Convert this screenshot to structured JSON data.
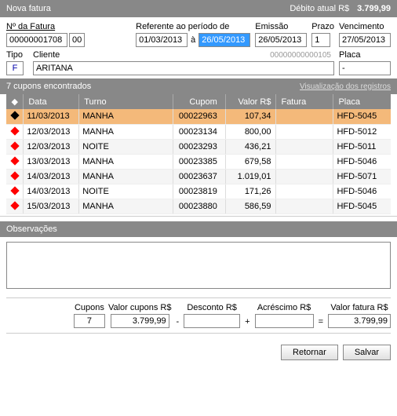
{
  "header": {
    "title": "Nova fatura",
    "debit_label": "Débito atual R$",
    "debit_value": "3.799,99"
  },
  "form": {
    "fatura_label": "Nº da Fatura",
    "fatura_num": "00000001708",
    "fatura_seq": "00",
    "ref_label": "Referente ao período de",
    "ref_from": "01/03/2013",
    "ref_sep": "à",
    "ref_to": "26/05/2013",
    "emissao_label": "Emissão",
    "emissao": "26/05/2013",
    "prazo_label": "Prazo",
    "prazo": "1",
    "venc_label": "Vencimento",
    "venc": "27/05/2013",
    "tipo_label": "Tipo",
    "tipo": "F",
    "cliente_label": "Cliente",
    "cliente": "ARITANA",
    "cliente_id": "00000000000105",
    "placa_label": "Placa",
    "placa": "-"
  },
  "list": {
    "count_label": "7 cupons encontrados",
    "vis_label": "Visualização dos registros",
    "cols": {
      "data": "Data",
      "turno": "Turno",
      "cupom": "Cupom",
      "valor": "Valor R$",
      "fatura": "Fatura",
      "placa": "Placa"
    },
    "rows": [
      {
        "sel": true,
        "data": "11/03/2013",
        "turno": "MANHA",
        "cupom": "00022963",
        "valor": "107,34",
        "fatura": "",
        "placa": "HFD-5045"
      },
      {
        "sel": false,
        "data": "12/03/2013",
        "turno": "MANHA",
        "cupom": "00023134",
        "valor": "800,00",
        "fatura": "",
        "placa": "HFD-5012"
      },
      {
        "sel": false,
        "data": "12/03/2013",
        "turno": "NOITE",
        "cupom": "00023293",
        "valor": "436,21",
        "fatura": "",
        "placa": "HFD-5011"
      },
      {
        "sel": false,
        "data": "13/03/2013",
        "turno": "MANHA",
        "cupom": "00023385",
        "valor": "679,58",
        "fatura": "",
        "placa": "HFD-5046"
      },
      {
        "sel": false,
        "data": "14/03/2013",
        "turno": "MANHA",
        "cupom": "00023637",
        "valor": "1.019,01",
        "fatura": "",
        "placa": "HFD-5071"
      },
      {
        "sel": false,
        "data": "14/03/2013",
        "turno": "NOITE",
        "cupom": "00023819",
        "valor": "171,26",
        "fatura": "",
        "placa": "HFD-5046"
      },
      {
        "sel": false,
        "data": "15/03/2013",
        "turno": "MANHA",
        "cupom": "00023880",
        "valor": "586,59",
        "fatura": "",
        "placa": "HFD-5045"
      }
    ]
  },
  "obs": {
    "label": "Observações",
    "text": ""
  },
  "totals": {
    "cupons_label": "Cupons",
    "cupons": "7",
    "valor_cupons_label": "Valor cupons R$",
    "valor_cupons": "3.799,99",
    "desconto_label": "Desconto R$",
    "desconto": "",
    "acrescimo_label": "Acréscimo R$",
    "acrescimo": "",
    "valor_fatura_label": "Valor fatura R$",
    "valor_fatura": "3.799,99"
  },
  "buttons": {
    "retornar": "Retornar",
    "salvar": "Salvar"
  }
}
